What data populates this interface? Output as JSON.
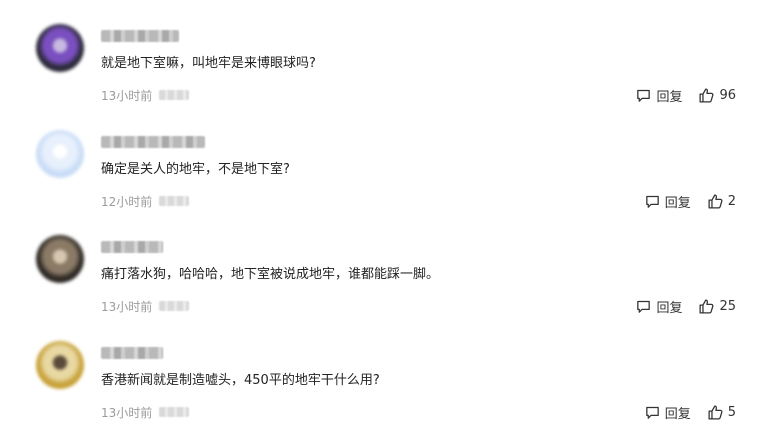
{
  "comments": [
    {
      "text": "就是地下室嘛，叫地牢是来博眼球吗?",
      "time": "13小时前",
      "reply_label": "回复",
      "likes": "96",
      "avatar_colors": [
        "#2d2b3a",
        "#7a4fc0",
        "#c7b9e0"
      ]
    },
    {
      "text": "确定是关人的地牢，不是地下室?",
      "time": "12小时前",
      "reply_label": "回复",
      "likes": "2",
      "avatar_colors": [
        "#c9dcf6",
        "#e7f0fc",
        "#ffffff"
      ]
    },
    {
      "text": "痛打落水狗，哈哈哈，地下室被说成地牢，谁都能踩一脚。",
      "time": "13小时前",
      "reply_label": "回复",
      "likes": "25",
      "avatar_colors": [
        "#2f2a25",
        "#8a7a66",
        "#d6c7b0"
      ]
    },
    {
      "text": "香港新闻就是制造嘘头，450平的地牢干什么用?",
      "time": "13小时前",
      "reply_label": "回复",
      "likes": "5",
      "avatar_colors": [
        "#c8a23a",
        "#e8d8a2",
        "#5a4a3a"
      ]
    }
  ]
}
